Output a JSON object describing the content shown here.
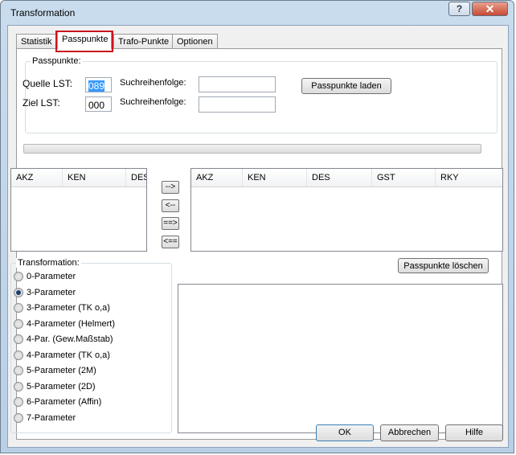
{
  "window": {
    "title": "Transformation"
  },
  "titlebar": {
    "help_label": "?",
    "close_label": "✕"
  },
  "tabs": [
    {
      "label": "Statistik"
    },
    {
      "label": "Passpunkte"
    },
    {
      "label": "Trafo-Punkte"
    },
    {
      "label": "Optionen"
    }
  ],
  "active_tab": "Passpunkte",
  "passpunkte": {
    "group_title": "Passpunkte:",
    "quelle_label": "Quelle LST:",
    "quelle_value": "089",
    "ziel_label": "Ziel LST:",
    "ziel_value": "000",
    "suchreihenfolge1_label": "Suchreihenfolge:",
    "suchreihenfolge1_value": "",
    "suchreihenfolge2_label": "Suchreihenfolge:",
    "suchreihenfolge2_value": "",
    "load_button": "Passpunkte laden",
    "progress": 0
  },
  "left_list": {
    "columns": [
      "AKZ",
      "KEN",
      "DES"
    ],
    "rows": []
  },
  "right_list": {
    "columns": [
      "AKZ",
      "KEN",
      "DES",
      "GST",
      "RKY"
    ],
    "rows": []
  },
  "move_buttons": {
    "right_one": "-->",
    "left_one": "<--",
    "right_all": "==>",
    "left_all": "<=="
  },
  "delete_button": "Passpunkte löschen",
  "transformation": {
    "group_title": "Transformation:",
    "options": [
      "0-Parameter",
      "3-Parameter",
      "3-Parameter (TK o,a)",
      "4-Parameter (Helmert)",
      "4-Par. (Gew.Maßstab)",
      "4-Parameter (TK o,a)",
      "5-Parameter (2M)",
      "5-Parameter (2D)",
      "6-Parameter (Affin)",
      "7-Parameter"
    ],
    "selected": "3-Parameter"
  },
  "dialog_buttons": {
    "ok": "OK",
    "cancel": "Abbrechen",
    "help": "Hilfe"
  }
}
